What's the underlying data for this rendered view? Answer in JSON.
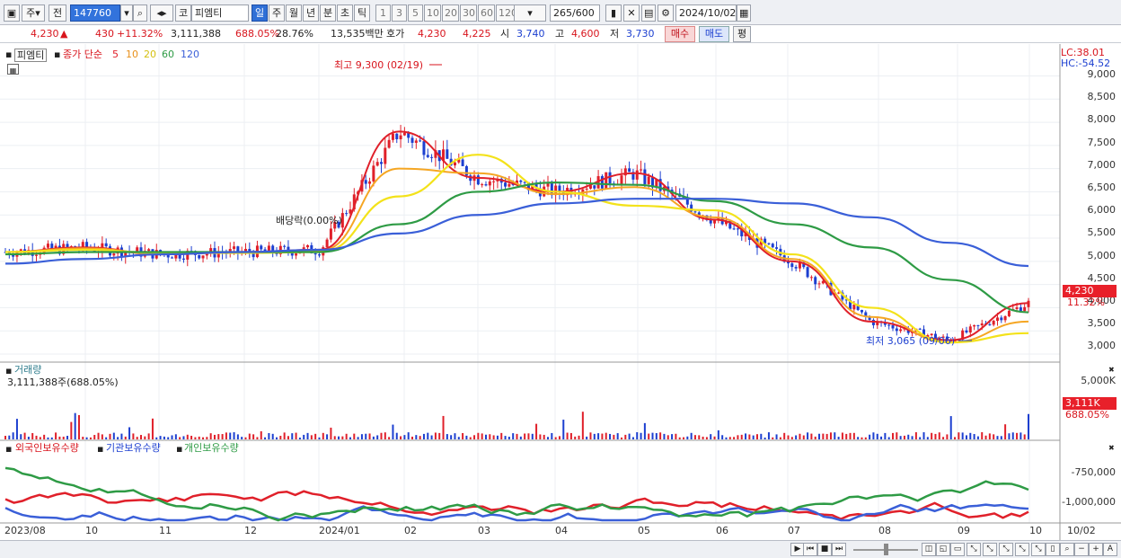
{
  "toolbar": {
    "type_label": "주",
    "prev_label": "전",
    "code_value": "147760",
    "market_label": "코",
    "stock_name": "피엠티",
    "periods": [
      "일",
      "주",
      "월",
      "년",
      "분",
      "초",
      "틱"
    ],
    "intervals": [
      "1",
      "3",
      "5",
      "10",
      "20",
      "30",
      "60",
      "120"
    ],
    "count_value": "265",
    "count_total": "/600",
    "date_value": "2024/10/02"
  },
  "quote": {
    "price": "4,230",
    "arrow": "▲",
    "change": "430",
    "change_pct": "+11.32%",
    "volume": "3,111,388",
    "volume_pct": "688.05%",
    "turnover": "28.76%",
    "amount": "13,535백만",
    "ask_label": "호가",
    "ask": "4,230",
    "bid": "4,225",
    "open_label": "시",
    "open": "3,740",
    "high_label": "고",
    "high": "4,600",
    "low_label": "저",
    "low": "3,730",
    "buy_label": "매수",
    "sell_label": "매도",
    "eval_label": "평"
  },
  "price_panel": {
    "name": "피엠티",
    "indicator_label": "종가 단순",
    "ma_labels": [
      "5",
      "10",
      "20",
      "60",
      "120"
    ],
    "lc": "LC:38.01",
    "hc": "HC:-54.52",
    "max_note": "최고 9,300 (02/19)",
    "min_note": "최저 3,065 (09/06)",
    "dividend_note": "배당락(0.00%)",
    "y_ticks": [
      "9,000",
      "8,500",
      "8,000",
      "7,500",
      "7,000",
      "6,500",
      "6,000",
      "5,500",
      "5,000",
      "4,500",
      "4,000",
      "3,500",
      "3,000"
    ],
    "price_badge": "4,230",
    "pct_badge": "11.32%"
  },
  "volume_panel": {
    "title": "거래량",
    "value_label": "3,111,388주(688.05%)",
    "y_tick": "5,000K",
    "badge": "3,111K",
    "pct": "688.05%"
  },
  "holding_panel": {
    "legend": [
      "외국인보유수량",
      "기관보유수량",
      "개인보유수량"
    ],
    "y_ticks": [
      "-750,000",
      "-1,000,000"
    ]
  },
  "x_axis": [
    "2023/08",
    "10",
    "11",
    "12",
    "2024/01",
    "02",
    "03",
    "04",
    "05",
    "06",
    "07",
    "08",
    "09",
    "10",
    "10/02"
  ],
  "colors": {
    "up": "#e0202a",
    "down": "#1c3fd0",
    "ma5": "#e0202a",
    "ma10": "#f5a623",
    "ma20": "#f3e21a",
    "ma60": "#2e9b45",
    "ma120": "#3a5fd8"
  },
  "chart_data": {
    "type": "line",
    "title": "",
    "xlabel": "",
    "ylabel": "",
    "ylim": [
      3000,
      9300
    ],
    "x": [
      "2023/08",
      "10",
      "11",
      "12",
      "2024/01",
      "02",
      "03",
      "04",
      "05",
      "06",
      "07",
      "08",
      "09",
      "10"
    ],
    "series": [
      {
        "name": "5",
        "values": [
          5200,
          5300,
          5150,
          5200,
          5250,
          7800,
          6800,
          6500,
          6900,
          5900,
          5000,
          3700,
          3300,
          4100
        ]
      },
      {
        "name": "10",
        "values": [
          5200,
          5280,
          5160,
          5190,
          5230,
          7000,
          6900,
          6450,
          6600,
          5950,
          5050,
          3800,
          3250,
          3700
        ]
      },
      {
        "name": "20",
        "values": [
          5200,
          5250,
          5180,
          5180,
          5200,
          6400,
          7300,
          6500,
          6200,
          6100,
          5150,
          4000,
          3250,
          3450
        ]
      },
      {
        "name": "60",
        "values": [
          5150,
          5200,
          5200,
          5200,
          5200,
          5800,
          6500,
          6700,
          6650,
          6300,
          5800,
          5300,
          4600,
          3900
        ]
      },
      {
        "name": "120",
        "values": [
          4950,
          5050,
          5150,
          5200,
          5250,
          5600,
          6000,
          6250,
          6350,
          6350,
          6250,
          5950,
          5400,
          4900
        ]
      }
    ]
  }
}
